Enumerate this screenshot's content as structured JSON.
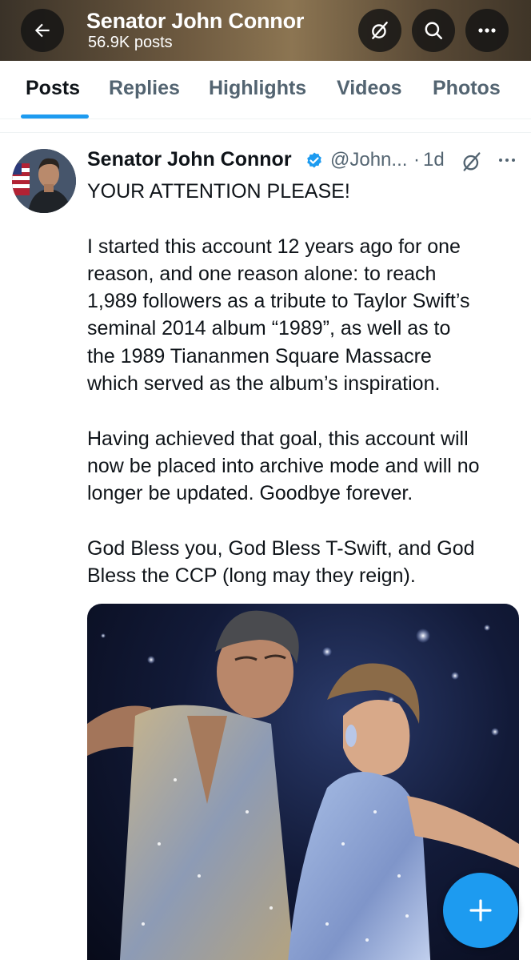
{
  "header": {
    "title": "Senator John Connor",
    "post_count": "56.9K posts"
  },
  "tabs": [
    {
      "label": "Posts",
      "active": true
    },
    {
      "label": "Replies",
      "active": false
    },
    {
      "label": "Highlights",
      "active": false
    },
    {
      "label": "Videos",
      "active": false
    },
    {
      "label": "Photos",
      "active": false
    }
  ],
  "post": {
    "author_name": "Senator John Connor",
    "verified": true,
    "handle": "@John...",
    "separator": "·",
    "time": "1d",
    "lines": [
      "YOUR ATTENTION PLEASE!",
      "",
      "I started this account 12 years ago for one",
      "reason, and one reason alone: to reach",
      "1,989 followers as a tribute to Taylor Swift’s",
      "seminal 2014 album “1989”, as well as to",
      "the 1989 Tiananmen Square Massacre",
      "which served as the album’s inspiration.",
      "",
      "Having achieved that goal, this account will",
      "now be placed into archive mode and will no",
      "longer be updated. Goodbye forever.",
      "",
      "God Bless you, God Bless T-Swift, and God",
      "Bless the CCP (long may they reign)."
    ]
  },
  "icons": {
    "back": "arrow-left-icon",
    "grok": "grok-icon",
    "search": "search-icon",
    "more": "more-icon",
    "compose": "plus-icon"
  },
  "colors": {
    "accent": "#1d9bf0",
    "text_primary": "#0f1419",
    "text_secondary": "#536471"
  }
}
